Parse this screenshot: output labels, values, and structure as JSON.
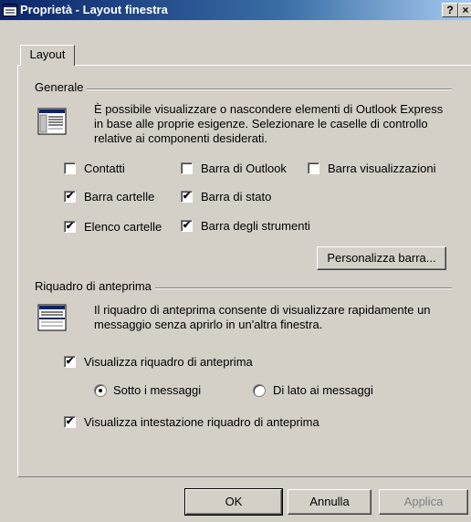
{
  "window": {
    "title": "Proprietà - Layout finestra",
    "help_label": "?",
    "close_label": "×"
  },
  "tabs": [
    {
      "label": "Layout"
    }
  ],
  "generale": {
    "label": "Generale",
    "description": "È possibile visualizzare o nascondere elementi di Outlook Express in base alle proprie esigenze. Selezionare le caselle di controllo relative ai componenti desiderati.",
    "checkboxes": {
      "contatti": {
        "label": "Contatti",
        "checked": false
      },
      "barra_outlook": {
        "label": "Barra di Outlook",
        "checked": false
      },
      "barra_visualizzazioni": {
        "label": "Barra visualizzazioni",
        "checked": false
      },
      "barra_cartelle": {
        "label": "Barra cartelle",
        "checked": true
      },
      "barra_stato": {
        "label": "Barra di stato",
        "checked": true
      },
      "elenco_cartelle": {
        "label": "Elenco cartelle",
        "checked": true
      },
      "barra_strumenti": {
        "label": "Barra degli strumenti",
        "checked": true
      }
    },
    "personalizza_label": "Personalizza barra..."
  },
  "anteprima": {
    "label": "Riquadro di anteprima",
    "description": "Il riquadro di anteprima consente di visualizzare rapidamente un messaggio senza aprirlo in un'altra finestra.",
    "visualizza": {
      "label": "Visualizza riquadro di anteprima",
      "checked": true
    },
    "radio_sotto": {
      "label": "Sotto i messaggi",
      "selected": true
    },
    "radio_lato": {
      "label": "Di lato ai messaggi",
      "selected": false
    },
    "intestazione": {
      "label": "Visualizza intestazione riquadro di anteprima",
      "checked": true
    }
  },
  "buttons": {
    "ok": "OK",
    "annulla": "Annulla",
    "applica": "Applica"
  },
  "check_glyph": "✔"
}
